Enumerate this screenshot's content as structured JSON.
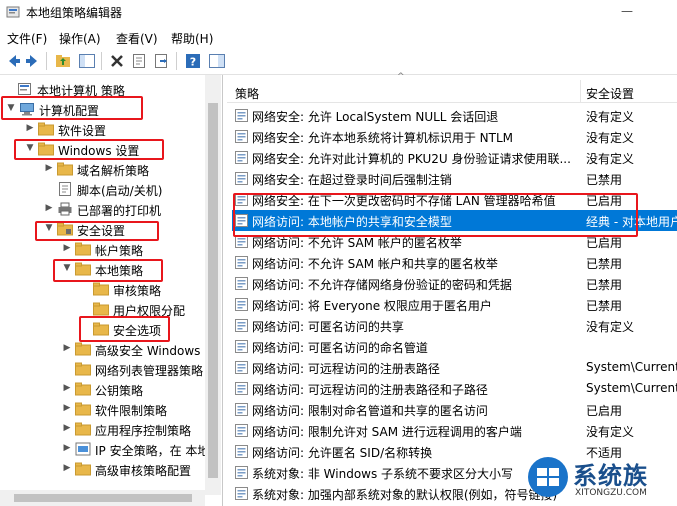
{
  "window": {
    "title": "本地组策略编辑器",
    "minimize_glyph": "—"
  },
  "menu": [
    {
      "label": "文件(F)"
    },
    {
      "label": "操作(A)"
    },
    {
      "label": "查看(V)"
    },
    {
      "label": "帮助(H)"
    }
  ],
  "toolbar": {
    "icons": [
      "back-icon",
      "forward-icon",
      "up-folder-icon",
      "show-hide-tree-icon",
      "delete-icon",
      "properties-icon",
      "export-list-icon",
      "help-icon",
      "show-pane-icon"
    ]
  },
  "tree": {
    "nodes": [
      {
        "label": "本地计算机 策略",
        "icon": "computer-policy-icon",
        "arrow": ""
      },
      {
        "label": "计算机配置",
        "icon": "computer-icon",
        "arrow": "▼"
      },
      {
        "label": "软件设置",
        "icon": "folder-icon",
        "arrow": "▶"
      },
      {
        "label": "Windows 设置",
        "icon": "folder-icon",
        "arrow": "▼"
      },
      {
        "label": "域名解析策略",
        "icon": "folder-icon",
        "arrow": "▶"
      },
      {
        "label": "脚本(启动/关机)",
        "icon": "script-icon",
        "arrow": ""
      },
      {
        "label": "已部署的打印机",
        "icon": "printer-icon",
        "arrow": "▶"
      },
      {
        "label": "安全设置",
        "icon": "security-folder-icon",
        "arrow": "▼"
      },
      {
        "label": "帐户策略",
        "icon": "folder-icon",
        "arrow": "▶"
      },
      {
        "label": "本地策略",
        "icon": "folder-icon",
        "arrow": "▼"
      },
      {
        "label": "审核策略",
        "icon": "folder-icon",
        "arrow": ""
      },
      {
        "label": "用户权限分配",
        "icon": "folder-icon",
        "arrow": ""
      },
      {
        "label": "安全选项",
        "icon": "folder-icon",
        "arrow": ""
      },
      {
        "label": "高级安全 Windows",
        "icon": "folder-icon",
        "arrow": "▶"
      },
      {
        "label": "网络列表管理器策略",
        "icon": "folder-icon",
        "arrow": ""
      },
      {
        "label": "公钥策略",
        "icon": "folder-icon",
        "arrow": "▶"
      },
      {
        "label": "软件限制策略",
        "icon": "folder-icon",
        "arrow": "▶"
      },
      {
        "label": "应用程序控制策略",
        "icon": "folder-icon",
        "arrow": "▶"
      },
      {
        "label": "IP 安全策略，在 本地",
        "icon": "ip-security-icon",
        "arrow": "▶"
      },
      {
        "label": "高级审核策略配置",
        "icon": "folder-icon",
        "arrow": "▶"
      }
    ]
  },
  "list": {
    "columns": {
      "policy": "策略",
      "setting": "安全设置"
    },
    "rows": [
      {
        "name": "网络安全: 允许 LocalSystem NULL 会话回退",
        "value": "没有定义"
      },
      {
        "name": "网络安全: 允许本地系统将计算机标识用于 NTLM",
        "value": "没有定义"
      },
      {
        "name": "网络安全: 允许对此计算机的 PKU2U 身份验证请求使用联...",
        "value": "没有定义"
      },
      {
        "name": "网络安全: 在超过登录时间后强制注销",
        "value": "已禁用"
      },
      {
        "name": "网络安全: 在下一次更改密码时不存储 LAN 管理器哈希值",
        "value": "已启用"
      },
      {
        "name": "网络访问: 本地帐户的共享和安全模型",
        "value": "经典 - 对本地用户"
      },
      {
        "name": "网络访问: 不允许 SAM 帐户的匿名枚举",
        "value": "已启用"
      },
      {
        "name": "网络访问: 不允许 SAM 帐户和共享的匿名枚举",
        "value": "已禁用"
      },
      {
        "name": "网络访问: 不允许存储网络身份验证的密码和凭据",
        "value": "已禁用"
      },
      {
        "name": "网络访问: 将 Everyone 权限应用于匿名用户",
        "value": "已禁用"
      },
      {
        "name": "网络访问: 可匿名访问的共享",
        "value": "没有定义"
      },
      {
        "name": "网络访问: 可匿名访问的命名管道",
        "value": ""
      },
      {
        "name": "网络访问: 可远程访问的注册表路径",
        "value": "System\\CurrentC"
      },
      {
        "name": "网络访问: 可远程访问的注册表路径和子路径",
        "value": "System\\CurrentC"
      },
      {
        "name": "网络访问: 限制对命名管道和共享的匿名访问",
        "value": "已启用"
      },
      {
        "name": "网络访问: 限制允许对 SAM 进行远程调用的客户端",
        "value": "没有定义"
      },
      {
        "name": "网络访问: 允许匿名 SID/名称转换",
        "value": "不适用"
      },
      {
        "name": "系统对象: 非 Windows 子系统不要求区分大小写",
        "value": ""
      },
      {
        "name": "系统对象: 加强内部系统对象的默认权限(例如，符号链接)",
        "value": ""
      }
    ],
    "selected_index": 5
  },
  "watermark": {
    "text": "系统族",
    "url_text": "XITONGZU.COM"
  },
  "colors": {
    "selection": "#0078d7",
    "annotation_red": "#e8161c",
    "folder": "#e8b74a"
  }
}
